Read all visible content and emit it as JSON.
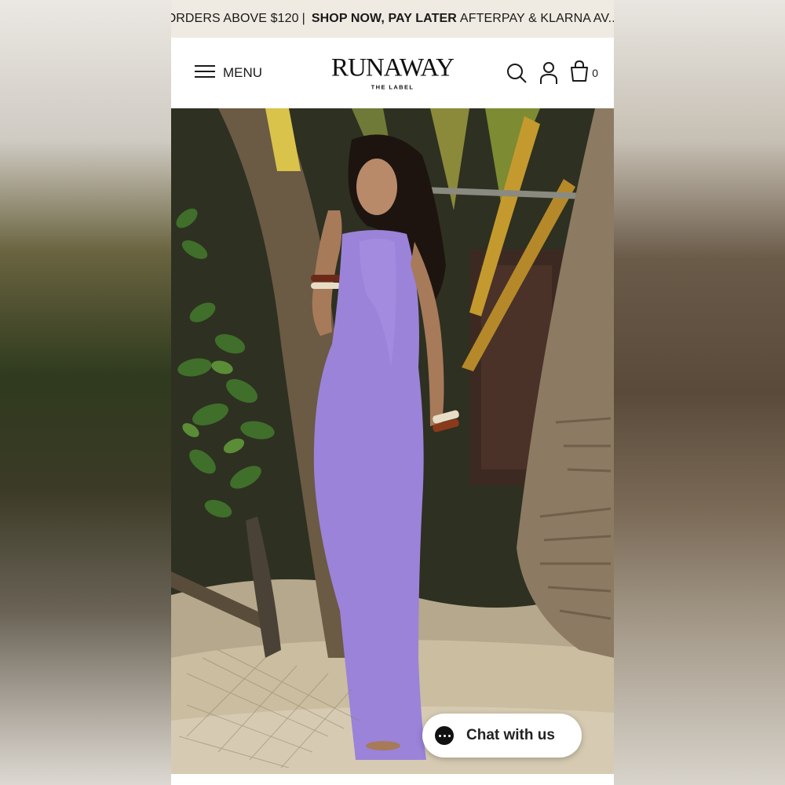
{
  "announcement": {
    "part1": "ORDERS ABOVE $120",
    "separator": "|",
    "part2": "SHOP NOW, PAY LATER",
    "part3": "AFTERPAY & KLARNA AV..."
  },
  "header": {
    "menu_label": "MENU",
    "logo_main": "RUNAWAY",
    "logo_sub": "THE LABEL",
    "cart_count": "0",
    "icons": [
      "hamburger-icon",
      "search-icon",
      "account-icon",
      "cart-bag-icon"
    ]
  },
  "hero": {
    "description_colors": {
      "dress": "#9b83d9",
      "foliage": "#3e6b2a",
      "sand": "#cbbd9f"
    }
  },
  "chat": {
    "label": "Chat with us",
    "icon": "chat-bubble-icon"
  },
  "colors": {
    "announcement_bg": "#efeae2",
    "header_bg": "#ffffff",
    "text": "#1a1a1a"
  }
}
